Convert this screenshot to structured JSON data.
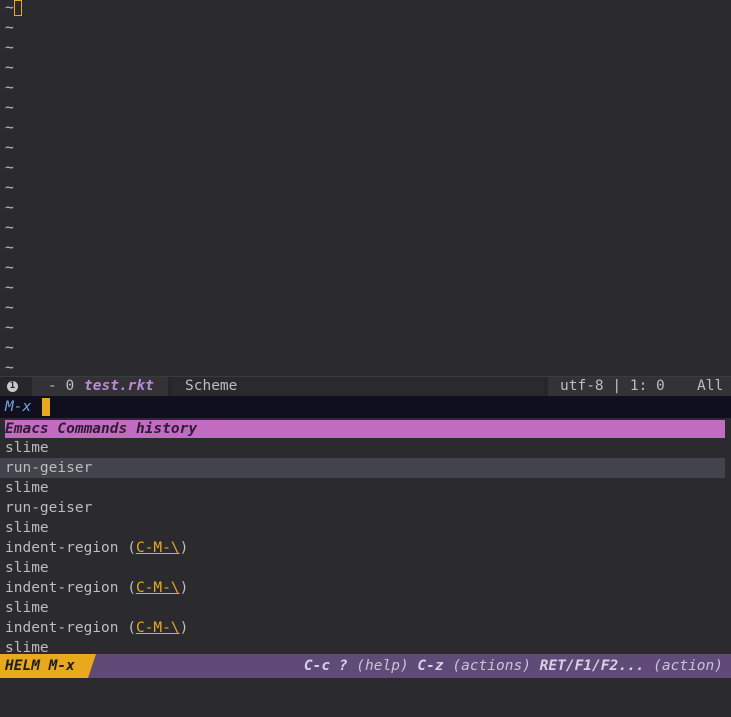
{
  "buffer": {
    "empty_line_marker": "~",
    "marker_count": 19
  },
  "modeline": {
    "window_number": "1",
    "modified": "- 0",
    "file_name": "test.rkt",
    "major_mode": "Scheme",
    "encoding_position": "utf-8 | 1: 0",
    "scroll": "All"
  },
  "minibuffer": {
    "prompt": "M-x"
  },
  "helm": {
    "source_header": "Emacs Commands history",
    "candidates": [
      {
        "name": "slime",
        "binding": ""
      },
      {
        "name": "run-geiser",
        "binding": "",
        "selected": true
      },
      {
        "name": "slime",
        "binding": ""
      },
      {
        "name": "run-geiser",
        "binding": ""
      },
      {
        "name": "slime",
        "binding": ""
      },
      {
        "name": "indent-region",
        "binding": "C-M-\\"
      },
      {
        "name": "slime",
        "binding": ""
      },
      {
        "name": "indent-region",
        "binding": "C-M-\\"
      },
      {
        "name": "slime",
        "binding": ""
      },
      {
        "name": "indent-region",
        "binding": "C-M-\\"
      },
      {
        "name": "slime",
        "binding": ""
      }
    ],
    "modeline": {
      "tag": "HELM M-x",
      "help": [
        {
          "key": "C-c ?",
          "desc": " (help) "
        },
        {
          "key": "C-z",
          "desc": " (actions) "
        },
        {
          "key": "RET/F1/F2...",
          "desc": " (action)"
        }
      ]
    }
  },
  "colors": {
    "background": "#2b2b2f",
    "accent": "#e9a91c",
    "header": "#c36ac1",
    "helm_modeline": "#5f4a78",
    "file_name": "#b98ad6"
  }
}
